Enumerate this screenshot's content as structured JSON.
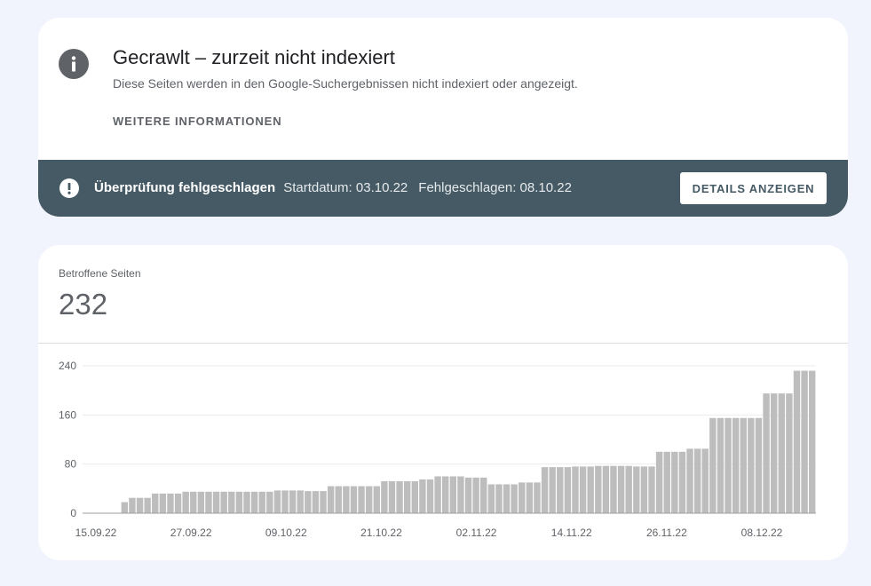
{
  "issue": {
    "title": "Gecrawlt – zurzeit nicht indexiert",
    "description": "Diese Seiten werden in den Google-Suchergebnissen nicht indexiert oder angezeigt.",
    "more_info_label": "WEITERE INFORMATIONEN",
    "icon": "info-icon"
  },
  "status": {
    "icon": "exclamation-icon",
    "label": "Überprüfung fehlgeschlagen",
    "start": "Startdatum: 03.10.22",
    "failed": "Fehlgeschlagen: 08.10.22",
    "details_button": "DETAILS ANZEIGEN",
    "bar_color": "#455a64"
  },
  "affected": {
    "label": "Betroffene Seiten",
    "value": "232"
  },
  "chart_data": {
    "type": "bar",
    "y_ticks": [
      "240",
      "160",
      "80",
      "0"
    ],
    "ylim": [
      0,
      240
    ],
    "x_tick_labels": [
      "15.09.22",
      "27.09.22",
      "09.10.22",
      "21.10.22",
      "02.11.22",
      "14.11.22",
      "26.11.22",
      "08.12.22"
    ],
    "bar_color": "#bdbdbd",
    "grid": true,
    "values": [
      0,
      0,
      0,
      0,
      0,
      18,
      25,
      25,
      25,
      32,
      32,
      32,
      32,
      35,
      35,
      35,
      35,
      35,
      35,
      35,
      35,
      35,
      35,
      35,
      35,
      37,
      37,
      37,
      37,
      36,
      36,
      36,
      44,
      44,
      44,
      44,
      44,
      44,
      44,
      52,
      52,
      52,
      52,
      52,
      55,
      55,
      60,
      60,
      60,
      60,
      58,
      58,
      58,
      47,
      47,
      47,
      47,
      50,
      50,
      50,
      75,
      75,
      75,
      75,
      76,
      76,
      76,
      77,
      77,
      77,
      77,
      77,
      76,
      76,
      76,
      100,
      100,
      100,
      100,
      105,
      105,
      105,
      155,
      155,
      155,
      155,
      155,
      155,
      155,
      195,
      195,
      195,
      195,
      232,
      232,
      232
    ]
  }
}
